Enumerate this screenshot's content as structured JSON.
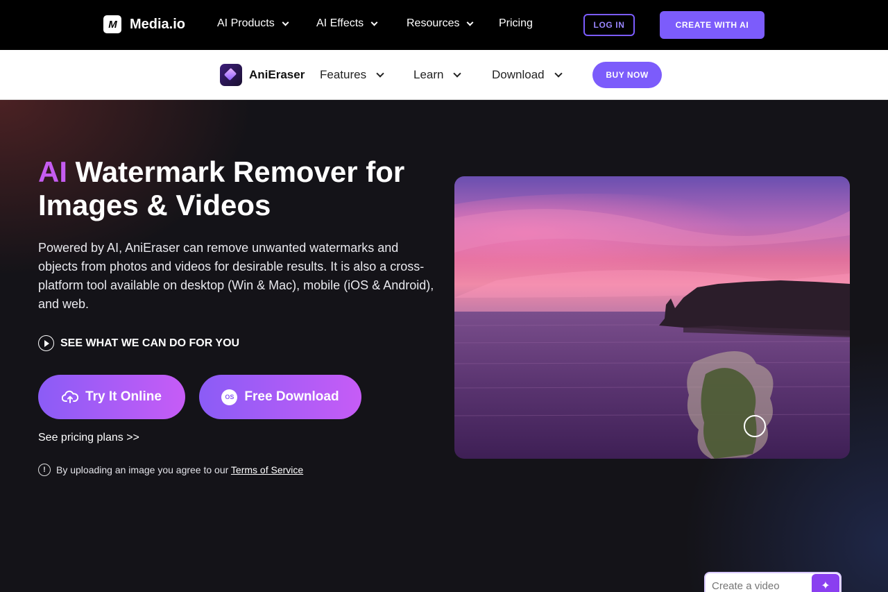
{
  "topnav": {
    "brand": "Media.io",
    "logo_mark": "M",
    "items": [
      {
        "label": "AI Products",
        "has_dropdown": true
      },
      {
        "label": "AI Effects",
        "has_dropdown": true
      },
      {
        "label": "Resources",
        "has_dropdown": true
      },
      {
        "label": "Pricing",
        "has_dropdown": false
      }
    ],
    "login_label": "LOG IN",
    "create_label": "CREATE WITH AI"
  },
  "subnav": {
    "product_name": "AniEraser",
    "items": [
      {
        "label": "Features",
        "has_dropdown": true
      },
      {
        "label": "Learn",
        "has_dropdown": true
      },
      {
        "label": "Download",
        "has_dropdown": true
      }
    ],
    "buy_label": "BUY NOW"
  },
  "hero": {
    "title_accent": "AI",
    "title_rest": " Watermark Remover for Images & Videos",
    "description": "Powered by AI, AniEraser can remove unwanted watermarks and objects from photos and videos for desirable results. It is also a cross-platform tool available on desktop (Win & Mac), mobile (iOS & Android), and web.",
    "see_label": "SEE WHAT WE CAN DO FOR YOU",
    "try_label": "Try It Online",
    "download_label": "Free Download",
    "os_badge": "OS",
    "pricing_link": "See pricing plans >>",
    "terms_text": "By uploading an image you agree to our ",
    "terms_link": "Terms of Service",
    "info_glyph": "!"
  },
  "chat": {
    "placeholder": "Create a video",
    "send_glyph": "✦"
  },
  "colors": {
    "accent": "#7c5cfb",
    "title_accent": "#c55cf0",
    "hero_bg": "#141318"
  },
  "icons": [
    "chevron-down-icon",
    "play-circle-icon",
    "cloud-upload-icon",
    "os-icon",
    "info-icon",
    "sparkle-icon"
  ]
}
